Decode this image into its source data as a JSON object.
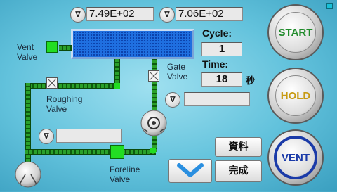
{
  "gauges": {
    "top_left_value": "7.49E+02",
    "top_right_value": "7.06E+02",
    "gate_value": "",
    "foreline_value": "",
    "icon_glyph": "∇"
  },
  "labels": {
    "vent_valve": [
      "Vent",
      "Valve"
    ],
    "gate_valve": [
      "Gate",
      "Valve"
    ],
    "roughing_valve": [
      "Roughing",
      "Valve"
    ],
    "foreline_valve": [
      "Foreline",
      "Valve"
    ]
  },
  "cycle": {
    "label": "Cycle:",
    "value": "1"
  },
  "time": {
    "label": "Time:",
    "value": "18",
    "unit": "秒"
  },
  "buttons": {
    "start": "START",
    "hold": "HOLD",
    "vent": "VENT",
    "data": "資料",
    "complete": "完成"
  },
  "colors": {
    "chamber": "#1f6fe0",
    "pipe": "#2aa02a",
    "valve_open": "#22dd22",
    "start_text": "#1f8a2a",
    "hold_text": "#c79a12",
    "vent_text": "#1a3aa8",
    "chevron": "#2a8fe0"
  }
}
